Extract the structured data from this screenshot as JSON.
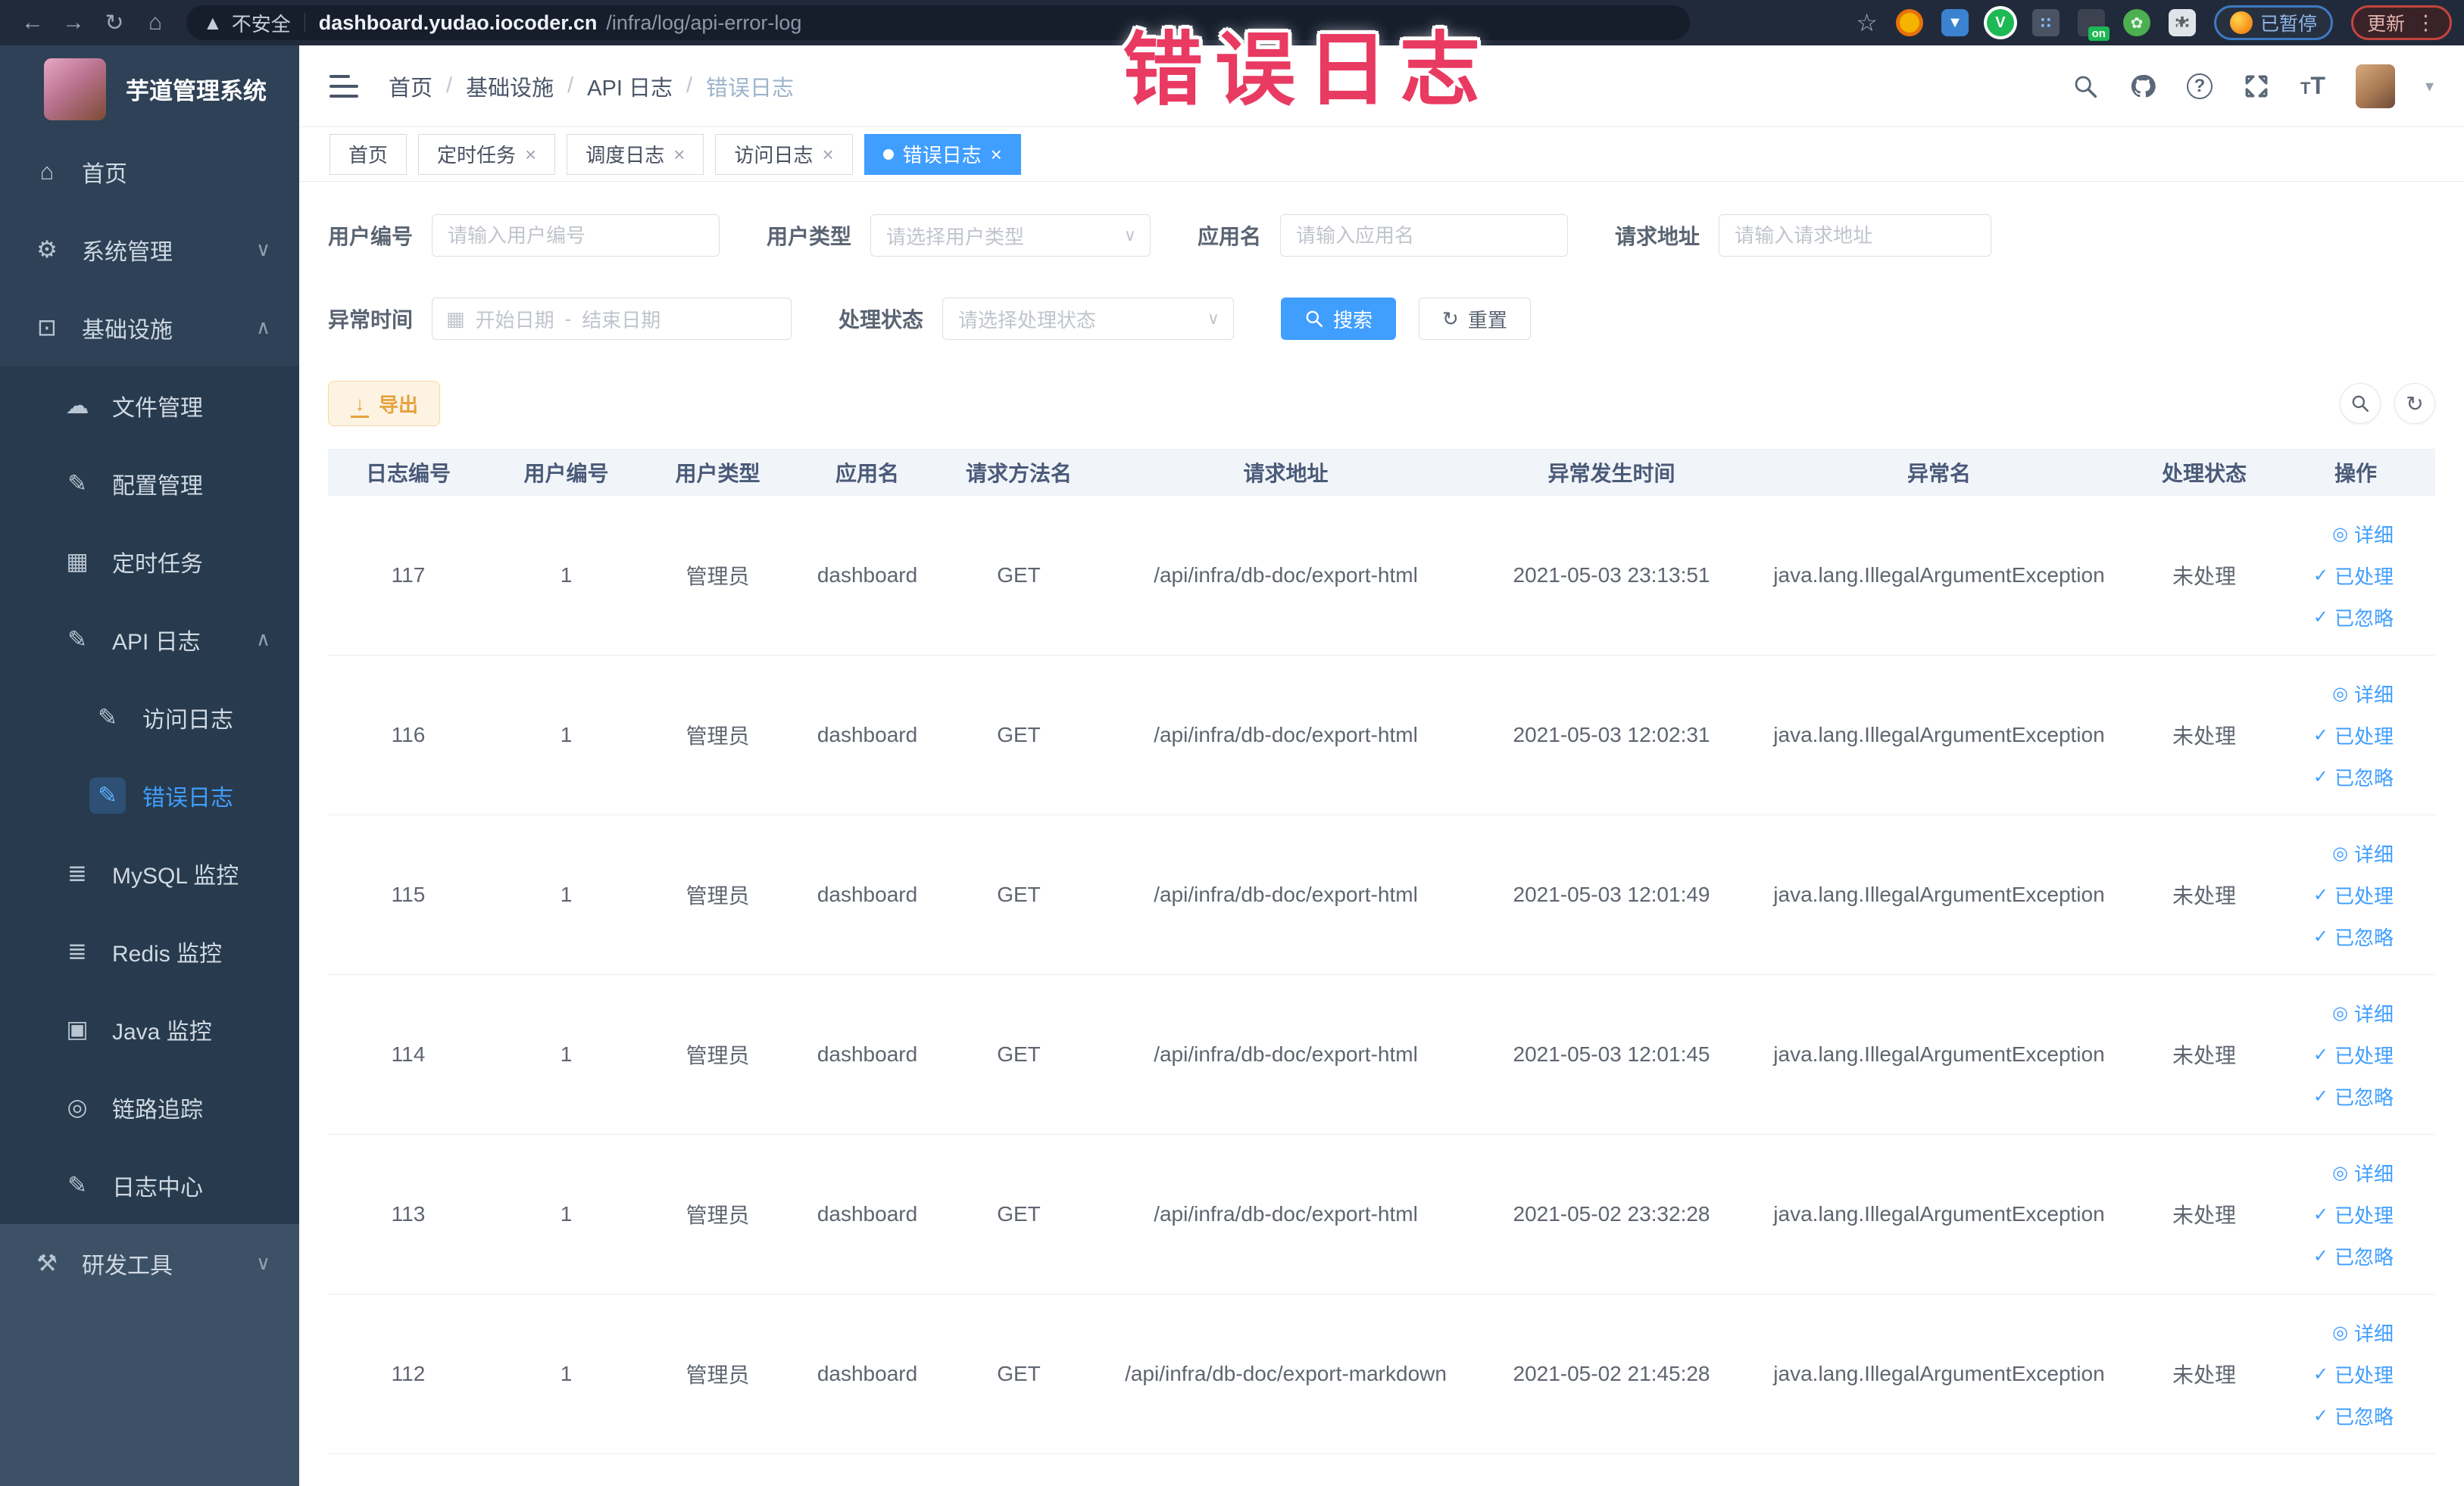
{
  "browser": {
    "security_label": "不安全",
    "url_domain": "dashboard.yudao.iocoder.cn",
    "url_path": "/infra/log/api-error-log",
    "paused_badge": "已暂停",
    "update_button": "更新",
    "on_badge": "on",
    "nav_icons": [
      "back-icon",
      "forward-icon",
      "reload-icon",
      "home-icon"
    ],
    "extension_icons": [
      "adblock-icon",
      "shield-icon",
      "green-check-icon",
      "grid-icon",
      "switch-on-icon",
      "leaf-icon",
      "puzzle-icon"
    ]
  },
  "watermark": "错误日志",
  "colors": {
    "accent": "#409eff",
    "warning": "#e6a23c",
    "watermark": "#e93a62",
    "sidebar_bg": "#2e4156"
  },
  "sidebar": {
    "app_title": "芋道管理系统",
    "items": [
      {
        "key": "home",
        "label": "首页",
        "icon": "home-icon",
        "depth": 0,
        "section": "base"
      },
      {
        "key": "system-management",
        "label": "系统管理",
        "icon": "gear-icon",
        "depth": 0,
        "section": "base",
        "chevron": "down"
      },
      {
        "key": "infrastructure",
        "label": "基础设施",
        "icon": "monitor-icon",
        "depth": 0,
        "section": "base",
        "chevron": "up"
      },
      {
        "key": "file-management",
        "label": "文件管理",
        "icon": "cloud-icon",
        "depth": 1,
        "section": "submenu"
      },
      {
        "key": "config-management",
        "label": "配置管理",
        "icon": "edit-icon",
        "depth": 1,
        "section": "submenu"
      },
      {
        "key": "scheduled-tasks",
        "label": "定时任务",
        "icon": "schedule-icon",
        "depth": 1,
        "section": "submenu"
      },
      {
        "key": "api-log",
        "label": "API 日志",
        "icon": "document-icon",
        "depth": 1,
        "section": "submenu",
        "chevron": "up"
      },
      {
        "key": "access-log",
        "label": "访问日志",
        "icon": "document-icon",
        "depth": 2,
        "section": "submenu"
      },
      {
        "key": "error-log",
        "label": "错误日志",
        "icon": "document-icon",
        "depth": 2,
        "section": "submenu",
        "active": true
      },
      {
        "key": "mysql-monitor",
        "label": "MySQL 监控",
        "icon": "database-icon",
        "depth": 1,
        "section": "submenu"
      },
      {
        "key": "redis-monitor",
        "label": "Redis 监控",
        "icon": "layers-icon",
        "depth": 1,
        "section": "submenu"
      },
      {
        "key": "java-monitor",
        "label": "Java 监控",
        "icon": "java-icon",
        "depth": 1,
        "section": "submenu"
      },
      {
        "key": "trace",
        "label": "链路追踪",
        "icon": "eye-icon",
        "depth": 1,
        "section": "submenu"
      },
      {
        "key": "log-center",
        "label": "日志中心",
        "icon": "log-icon",
        "depth": 1,
        "section": "submenu"
      },
      {
        "key": "dev-tools",
        "label": "研发工具",
        "icon": "toolbox-icon",
        "depth": 0,
        "section": "footer",
        "chevron": "down"
      }
    ]
  },
  "header": {
    "breadcrumb": [
      "首页",
      "基础设施",
      "API 日志",
      "错误日志"
    ],
    "separator": "/",
    "icons": [
      "search-icon",
      "github-icon",
      "help-icon",
      "fullscreen-icon",
      "font-size-icon",
      "avatar",
      "caret-down-icon"
    ]
  },
  "tabs": [
    {
      "key": "home",
      "label": "首页",
      "closable": false,
      "active": false
    },
    {
      "key": "scheduled-tasks",
      "label": "定时任务",
      "closable": true,
      "active": false
    },
    {
      "key": "schedule-log",
      "label": "调度日志",
      "closable": true,
      "active": false
    },
    {
      "key": "access-log",
      "label": "访问日志",
      "closable": true,
      "active": false
    },
    {
      "key": "error-log",
      "label": "错误日志",
      "closable": true,
      "active": true
    }
  ],
  "filters": {
    "user_id": {
      "label": "用户编号",
      "placeholder": "请输入用户编号"
    },
    "user_type": {
      "label": "用户类型",
      "placeholder": "请选择用户类型"
    },
    "app_name": {
      "label": "应用名",
      "placeholder": "请输入应用名"
    },
    "request_url": {
      "label": "请求地址",
      "placeholder": "请输入请求地址"
    },
    "exception_time": {
      "label": "异常时间",
      "start_placeholder": "开始日期",
      "separator": "-",
      "end_placeholder": "结束日期"
    },
    "process_status": {
      "label": "处理状态",
      "placeholder": "请选择处理状态"
    },
    "search_button": "搜索",
    "reset_button": "重置"
  },
  "toolbar": {
    "export_button": "导出"
  },
  "table": {
    "columns": [
      "日志编号",
      "用户编号",
      "用户类型",
      "应用名",
      "请求方法名",
      "请求地址",
      "异常发生时间",
      "异常名",
      "处理状态",
      "操作"
    ],
    "row_actions": [
      "详细",
      "已处理",
      "已忽略"
    ],
    "rows": [
      [
        "117",
        "1",
        "管理员",
        "dashboard",
        "GET",
        "/api/infra/db-doc/export-html",
        "2021-05-03 23:13:51",
        "java.lang.IllegalArgumentException",
        "未处理"
      ],
      [
        "116",
        "1",
        "管理员",
        "dashboard",
        "GET",
        "/api/infra/db-doc/export-html",
        "2021-05-03 12:02:31",
        "java.lang.IllegalArgumentException",
        "未处理"
      ],
      [
        "115",
        "1",
        "管理员",
        "dashboard",
        "GET",
        "/api/infra/db-doc/export-html",
        "2021-05-03 12:01:49",
        "java.lang.IllegalArgumentException",
        "未处理"
      ],
      [
        "114",
        "1",
        "管理员",
        "dashboard",
        "GET",
        "/api/infra/db-doc/export-html",
        "2021-05-03 12:01:45",
        "java.lang.IllegalArgumentException",
        "未处理"
      ],
      [
        "113",
        "1",
        "管理员",
        "dashboard",
        "GET",
        "/api/infra/db-doc/export-html",
        "2021-05-02 23:32:28",
        "java.lang.IllegalArgumentException",
        "未处理"
      ],
      [
        "112",
        "1",
        "管理员",
        "dashboard",
        "GET",
        "/api/infra/db-doc/export-markdown",
        "2021-05-02 21:45:28",
        "java.lang.IllegalArgumentException",
        "未处理"
      ]
    ]
  }
}
